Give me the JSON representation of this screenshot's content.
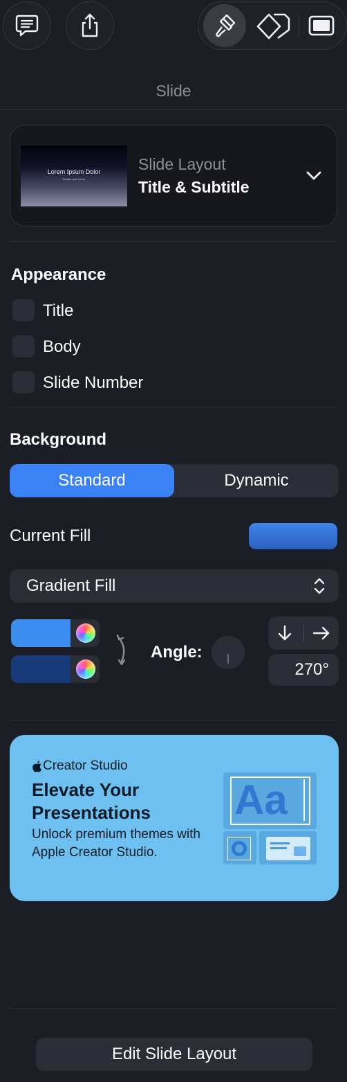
{
  "panel": {
    "title": "Slide"
  },
  "toolbar": {
    "comment_icon": "comment-bubble-icon",
    "share_icon": "share-icon",
    "format_icon": "paintbrush-icon",
    "animate_icon": "diamond-icon",
    "document_icon": "slide-icon"
  },
  "layout": {
    "label": "Slide Layout",
    "value": "Title & Subtitle",
    "thumb_title": "Lorem Ipsum Dolor",
    "thumb_subtitle": "Sedate apte lorem"
  },
  "appearance": {
    "heading": "Appearance",
    "items": [
      {
        "label": "Title",
        "checked": false
      },
      {
        "label": "Body",
        "checked": false
      },
      {
        "label": "Slide Number",
        "checked": false
      }
    ]
  },
  "background": {
    "heading": "Background",
    "segments": [
      "Standard",
      "Dynamic"
    ],
    "selected_segment": "Standard",
    "current_fill_label": "Current Fill",
    "fill_type": "Gradient Fill",
    "stops": [
      {
        "color": "#3b8df0"
      },
      {
        "color": "#173a7a"
      }
    ],
    "angle_label": "Angle:",
    "angle_value": "270°",
    "accent": "#3b82f6"
  },
  "promo": {
    "brand": "Creator Studio",
    "headline": "Elevate Your Presentations",
    "body": "Unlock premium themes with Apple Creator Studio.",
    "illustration_text": "Aa",
    "bg_color": "#6ec0f0"
  },
  "footer": {
    "edit_button": "Edit Slide Layout"
  }
}
